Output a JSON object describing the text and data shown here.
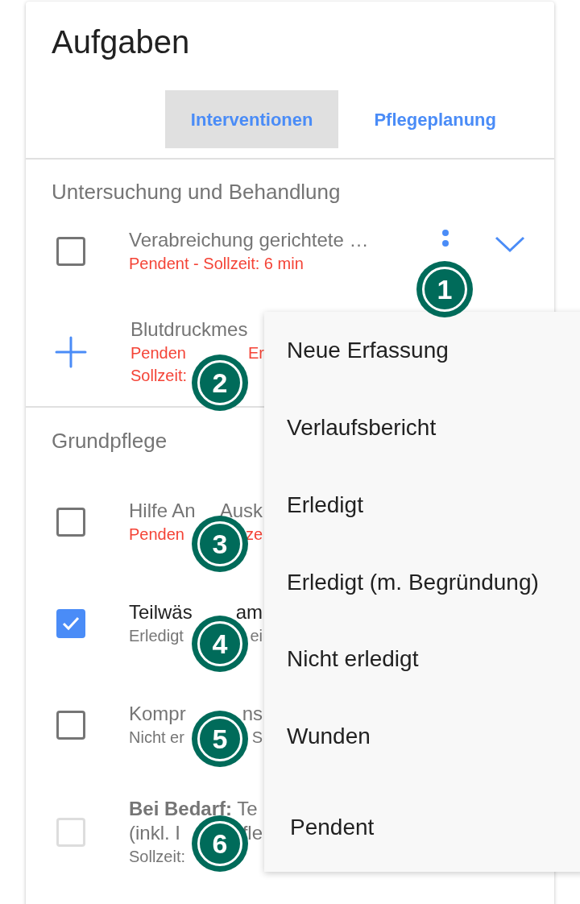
{
  "title": "Aufgaben",
  "tabs": [
    {
      "label": "Interventionen",
      "selected": true
    },
    {
      "label": "Pflegeplanung",
      "selected": false
    }
  ],
  "sections": [
    {
      "header": "Untersuchung und Behandlung",
      "items": [
        {
          "kind": "checkbox",
          "checked": false,
          "disabled": false,
          "title": [
            "Verabreichung gerichtete …"
          ],
          "alert": true,
          "lines": [
            [
              "Pendent - Sollzeit: 6 min"
            ]
          ],
          "actions": true
        },
        {
          "kind": "add",
          "title": [
            "Blutdruckmes"
          ],
          "alert": true,
          "lines": [
            [
              "Penden",
              "Er"
            ],
            [
              "Sollzeit:"
            ]
          ]
        }
      ]
    },
    {
      "header": "Grundpflege",
      "items": [
        {
          "kind": "checkbox",
          "checked": false,
          "disabled": false,
          "title": [
            "Hilfe An",
            "Ausk"
          ],
          "alert": true,
          "lines": [
            [
              "Penden",
              "ze"
            ]
          ]
        },
        {
          "kind": "checkbox",
          "checked": true,
          "disabled": false,
          "title": [
            "Teilwäs",
            "am"
          ],
          "alert": false,
          "lines": [
            [
              "Erledigt",
              "ei"
            ]
          ]
        },
        {
          "kind": "checkbox",
          "checked": false,
          "disabled": false,
          "title": [
            "Kompr",
            "ns"
          ],
          "alert": false,
          "lines": [
            [
              "Nicht er",
              "S"
            ]
          ]
        },
        {
          "kind": "checkbox",
          "checked": false,
          "disabled": true,
          "title": [
            "**Bei Bedarf:** Te"
          ],
          "title_2": [
            "(inkl. I",
            "fle"
          ],
          "alert": false,
          "lines": [
            [
              "Sollzeit:"
            ]
          ]
        }
      ]
    }
  ],
  "menu": [
    "Neue Erfassung",
    "Verlaufsbericht",
    "Erledigt",
    "Erledigt (m. Begründung)",
    "Nicht erledigt",
    "Wunden",
    "Pendent"
  ],
  "callouts": [
    "1",
    "2",
    "3",
    "4",
    "5",
    "6"
  ]
}
